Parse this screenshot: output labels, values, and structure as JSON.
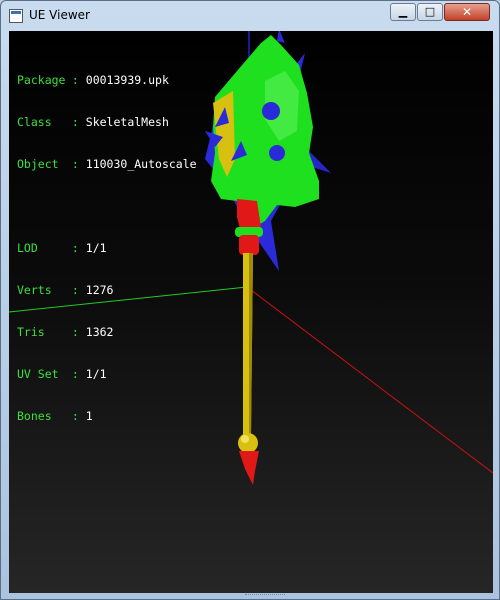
{
  "window": {
    "title": "UE Viewer",
    "controls": {
      "minimize": "▁",
      "maximize": "□",
      "close": "✕"
    }
  },
  "info": [
    {
      "key": "Package",
      "value": "00013939.upk"
    },
    {
      "key": "Class",
      "value": "SkeletalMesh"
    },
    {
      "key": "Object",
      "value": "110030_Autoscale"
    },
    {
      "key": "LOD",
      "value": "1/1"
    },
    {
      "key": "Verts",
      "value": "1276"
    },
    {
      "key": "Tris",
      "value": "1362"
    },
    {
      "key": "UV Set",
      "value": "1/1"
    },
    {
      "key": "Bones",
      "value": "1"
    }
  ],
  "colors": {
    "info_label": "#3ce03c",
    "info_value": "#ffffff",
    "axis_x": "#cc1111",
    "axis_y": "#22cc22",
    "axis_z": "#2222cc",
    "mesh_green": "#1ee01e",
    "mesh_blue": "#2a2ad8",
    "mesh_red": "#e01818",
    "mesh_yellow": "#d8c010"
  }
}
